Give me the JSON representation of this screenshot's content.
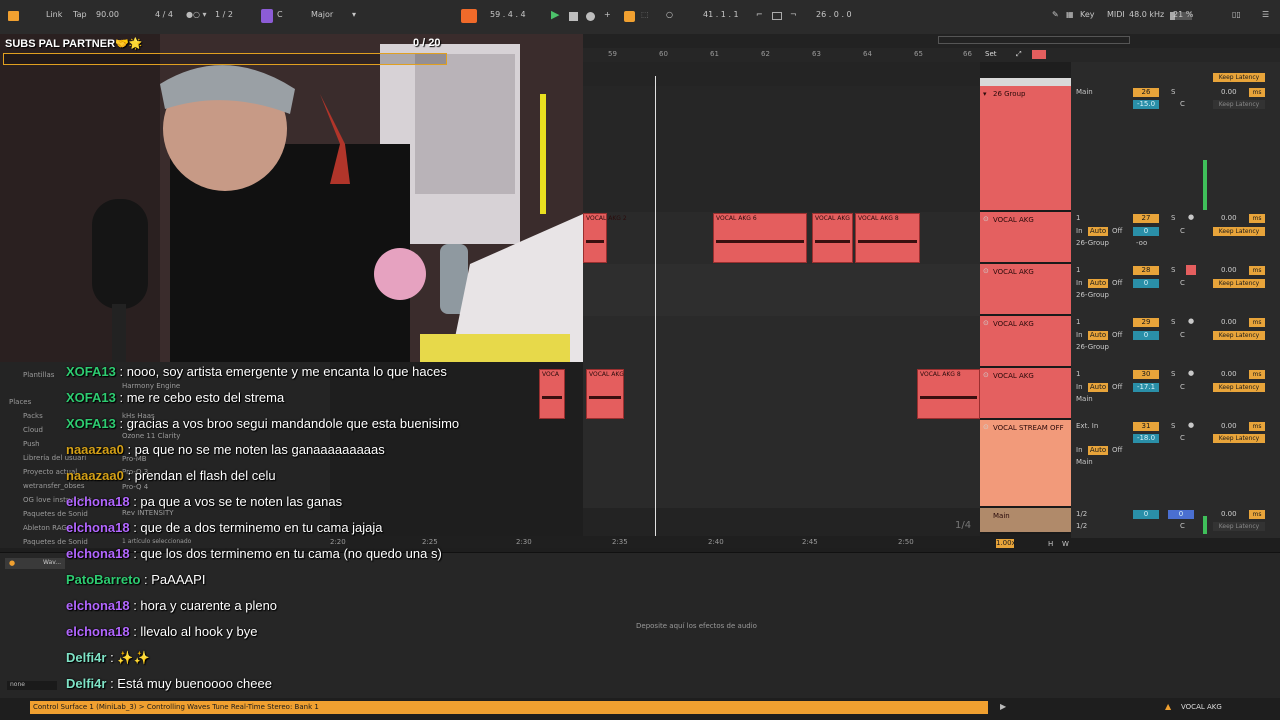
{
  "transport": {
    "link": "Link",
    "tap": "Tap",
    "tempo": "90.00",
    "signature": "4 / 4",
    "quantize": "1 / 2",
    "key_root": "C",
    "scale": "Major",
    "position": "59 .   4 .   4",
    "loop_start": "41 .   1 .   1",
    "loop_length": "26 .   0 .   0",
    "key_label": "Key",
    "midi_label": "MIDI",
    "sample_rate": "48.0 kHz",
    "cpu": "21 %"
  },
  "overlay": {
    "title": "SUBS PAL PARTNER🤝🌟",
    "progress_text": "0   / 20",
    "progress_value": 0,
    "progress_max": 20
  },
  "ruler": {
    "bars": [
      "59",
      "60",
      "61",
      "62",
      "63",
      "64",
      "65",
      "66"
    ],
    "times": [
      "2:20",
      "2:25",
      "2:30",
      "2:35",
      "2:40",
      "2:45",
      "2:50"
    ],
    "set_label": "Set",
    "page_indicator": "1/4",
    "zoom": "1.00x"
  },
  "clips": {
    "c1": "VOCAL AKG 2",
    "c2": "VOCAL AKG 6",
    "c3": "VOCAL AKG",
    "c4": "VOCAL AKG 8",
    "c5": "VOCA",
    "c6": "VOCAL AKG",
    "c7": "VOCAL AKG 8"
  },
  "tracks": [
    {
      "name": "26 Group",
      "number": "26",
      "routing": "Main",
      "vol": "0.00",
      "pan": "-15.0"
    },
    {
      "name": "VOCAL AKG",
      "number": "27",
      "input": "1",
      "monitor_auto": "Auto",
      "monitor_off": "Off",
      "routing": "26-Group",
      "vol": "0.00",
      "pan": "0"
    },
    {
      "name": "VOCAL AKG",
      "number": "28",
      "input": "1",
      "monitor_auto": "Auto",
      "monitor_off": "Off",
      "routing": "26-Group",
      "vol": "0.00",
      "pan": "0"
    },
    {
      "name": "VOCAL AKG",
      "number": "29",
      "input": "1",
      "monitor_auto": "Auto",
      "monitor_off": "Off",
      "routing": "26-Group",
      "vol": "0.00",
      "pan": "0"
    },
    {
      "name": "VOCAL AKG",
      "number": "30",
      "input": "1",
      "monitor_auto": "Auto",
      "monitor_off": "Off",
      "routing": "Main",
      "vol": "0.00",
      "pan": "-17.1"
    },
    {
      "name": "VOCAL STREAM OFF",
      "number": "31",
      "input": "Ext. In",
      "monitor_auto": "Auto",
      "monitor_off": "Off",
      "routing": "Main",
      "vol": "0.00",
      "pan": "-18.0"
    }
  ],
  "master": {
    "name": "Main",
    "routing_a": "1/2",
    "routing_b": "1/2",
    "vol": "0.00",
    "pan": "0",
    "cue": "0"
  },
  "labels": {
    "keep_latency": "Keep Latency",
    "ms": "ms",
    "in": "In",
    "solo": "S",
    "center": "C",
    "neg_inf": "-oo",
    "h": "H",
    "w": "W"
  },
  "browser": {
    "plantillas": "Plantillas",
    "places": "Places",
    "packs": "Packs",
    "cloud": "Cloud",
    "push": "Push",
    "libreria": "Librería del usuari",
    "proyecto": "Proyecto actual",
    "wetransfer": "wetransfer_obses",
    "og_love": "OG love instrument",
    "paquetes1": "Paquetes de Sonid",
    "ableton": "Ableton RAG",
    "paquetes2": "Paquetes de Sonid",
    "items": [
      "Harmony Engine",
      "kHs Haas",
      "Ozone 11 Clarity",
      "Pro-MB",
      "Pro-Q 3",
      "Pro-Q 4",
      "Rev INTENSITY"
    ],
    "selected": "1 artículo seleccionado",
    "device_label": "Wav...",
    "none": "none"
  },
  "device_panel": {
    "drop_hint": "Deposite aquí los efectos de audio"
  },
  "chat": [
    {
      "user": "XOFA13",
      "color": "#2ecc71",
      "msg": " : nooo, soy artista emergente y me encanta lo que haces"
    },
    {
      "user": "XOFA13",
      "color": "#2ecc71",
      "msg": " : me re cebo esto del strema"
    },
    {
      "user": "XOFA13",
      "color": "#2ecc71",
      "msg": " : gracias a vos broo segui mandandole que esta buenisimo"
    },
    {
      "user": "naaazaa0",
      "color": "#d4a017",
      "msg": " : pa que no se me noten las ganaaaaaaaaas"
    },
    {
      "user": "naaazaa0",
      "color": "#d4a017",
      "msg": " : prendan el flash del celu"
    },
    {
      "user": "elchona18",
      "color": "#b266ff",
      "msg": " : pa que a vos se te noten las ganas"
    },
    {
      "user": "elchona18",
      "color": "#b266ff",
      "msg": " : que de a dos terminemo en tu cama jajaja"
    },
    {
      "user": "elchona18",
      "color": "#b266ff",
      "msg": " : que los dos terminemo en tu cama (no quedo una s)"
    },
    {
      "user": "PatoBarreto",
      "color": "#2ecc71",
      "msg": " : PaAAAPI"
    },
    {
      "user": "elchona18",
      "color": "#b266ff",
      "msg": " : hora y cuarente a pleno"
    },
    {
      "user": "elchona18",
      "color": "#b266ff",
      "msg": " : llevalo al hook y bye"
    },
    {
      "user": "Delfi4r",
      "color": "#7fe3c6",
      "msg": " : ✨✨"
    },
    {
      "user": "Delfi4r",
      "color": "#7fe3c6",
      "msg": " : Está muy buenoooo cheee"
    }
  ],
  "status_bar": {
    "text": "Control Surface 1 (MiniLab_3) > Controlling Waves Tune Real-Time Stereo: Bank 1",
    "track": "VOCAL AKG"
  },
  "colors": {
    "accent": "#f0a030",
    "clip": "#e45e5e",
    "track_header": "#e46060",
    "stream_track": "#f29a7a",
    "master": "#b08a6a"
  }
}
